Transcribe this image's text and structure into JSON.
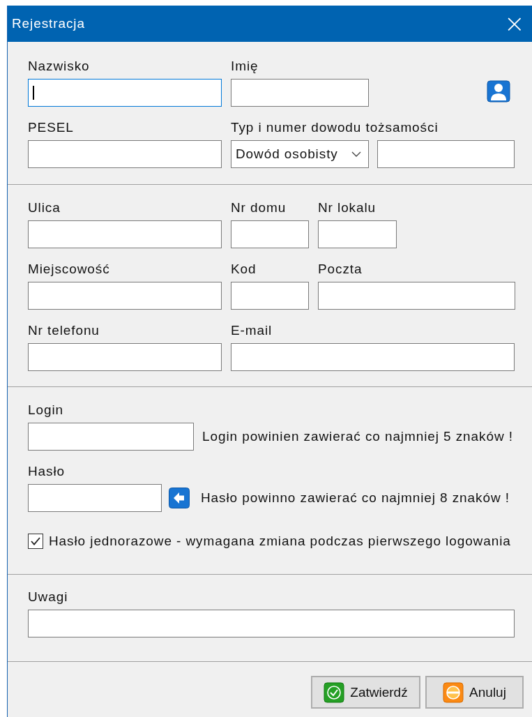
{
  "window": {
    "title": "Rejestracja",
    "close": "×"
  },
  "personal": {
    "surname": {
      "label": "Nazwisko",
      "focused": true
    },
    "first_name": {
      "label": "Imię",
      "focused": false
    },
    "pesel": {
      "label": "PESEL",
      "focused": false
    },
    "id_document": {
      "label": "Typ i numer dowodu tożsamości",
      "type_value": "Dowód osobisty",
      "focused": false
    }
  },
  "address": {
    "street": {
      "label": "Ulica",
      "focused": false
    },
    "house_no": {
      "label": "Nr domu",
      "focused": false
    },
    "flat_no": {
      "label": "Nr lokalu",
      "focused": false
    },
    "city": {
      "label": "Miejscowość",
      "focused": false
    },
    "postcode": {
      "label": "Kod",
      "focused": false
    },
    "post_office": {
      "label": "Poczta",
      "focused": false
    },
    "phone": {
      "label": "Nr telefonu",
      "focused": false
    },
    "email": {
      "label": "E-mail",
      "focused": false
    }
  },
  "account": {
    "login": {
      "label": "Login",
      "focused": false,
      "hint": "Login powinien zawierać co najmniej 5 znaków !"
    },
    "password": {
      "label": "Hasło",
      "focused": false,
      "hint": "Hasło powinno zawierać co najmniej 8 znaków !"
    },
    "one_time_password": {
      "label": "Hasło jednorazowe - wymagana zmiana podczas pierwszego logowania",
      "checked": true
    }
  },
  "notes": {
    "label": "Uwagi",
    "focused": false
  },
  "buttons": [
    {
      "kind": "confirm",
      "label": "Zatwierdź"
    },
    {
      "kind": "cancel",
      "label": "Anuluj"
    }
  ]
}
